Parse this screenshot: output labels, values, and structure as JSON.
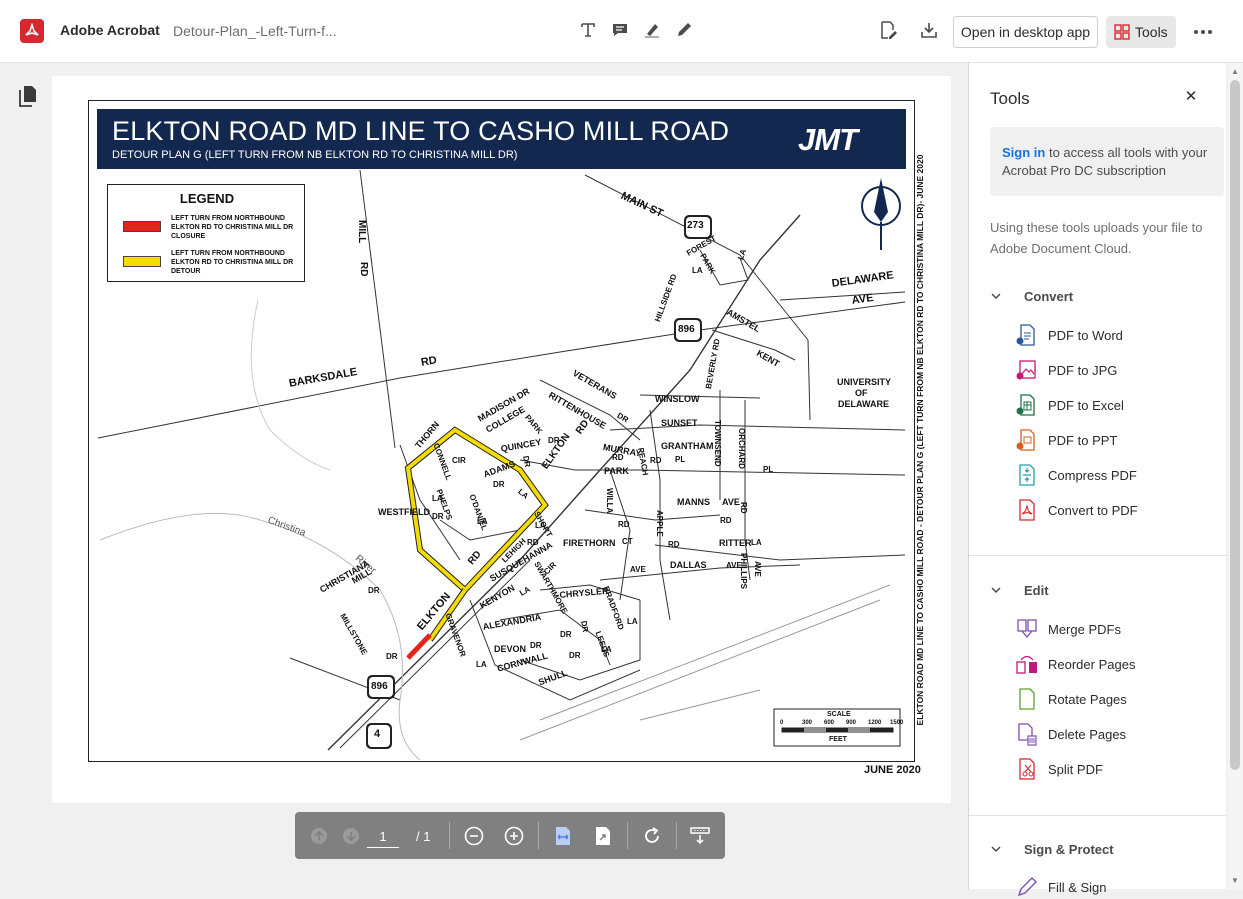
{
  "app": {
    "name": "Adobe Acrobat",
    "file_name": "Detour-Plan_-Left-Turn-f..."
  },
  "toolbar": {
    "open_desktop": "Open in desktop app",
    "tools_label": "Tools"
  },
  "map": {
    "title": "ELKTON ROAD MD LINE TO CASHO MILL ROAD",
    "subtitle": "DETOUR PLAN G (LEFT TURN FROM NB ELKTON RD TO CHRISTINA MILL DR)",
    "logo": "JMT",
    "legend_title": "LEGEND",
    "legend_closure": "LEFT TURN FROM NORTHBOUND ELKTON RD TO CHRISTINA MILL DR CLOSURE",
    "legend_detour": "LEFT TURN FROM NORTHBOUND ELKTON RD TO CHRISTINA MILL DR DETOUR",
    "date": "JUNE 2020",
    "side_note": "ELKTON ROAD MD LINE TO CASHO MILL ROAD - DETOUR PLAN G (LEFT TURN FROM NB ELKTON RD TO CHRISTINA MILL DR)- JUNE 2020",
    "scale_label": "SCALE",
    "scale_unit": "FEET",
    "scale_ticks": [
      "0",
      "300",
      "600",
      "900",
      "1200",
      "1500"
    ],
    "closure_color": "#e1251b",
    "detour_color": "#f5dc00",
    "labels": {
      "main_st": "MAIN ST",
      "r273": "273",
      "forest_park": "FOREST",
      "park_la": "PARK",
      "la1": "LA",
      "la2": "LA",
      "delaware": "DELAWARE",
      "ave": "AVE",
      "amstel": "AMSTEL",
      "kent": "KENT",
      "r896a": "896",
      "hillside": "HILLSIDE RD",
      "mill": "MILL",
      "rd_mill": "RD",
      "barksdale": "BARKSDALE",
      "rd_bark": "RD",
      "univ1": "UNIVERSITY",
      "univ2": "OF",
      "univ3": "DELAWARE",
      "veterans": "VETERANS",
      "dr_vet": "DR",
      "rittenhouse": "RITTENHOUSE",
      "winslow": "WINSLOW",
      "beverly": "BEVERLY RD",
      "sunset": "SUNSET",
      "townsend": "TOWNSEND",
      "orchard": "ORCHARD",
      "madison": "MADISON DR",
      "college": "COLLEGE",
      "park_c": "PARK",
      "thorn": "THORN",
      "connell": "CONNELL",
      "cir": "CIR",
      "quincey": "QUINCEY",
      "dr_q": "DR",
      "dr_q2": "DR",
      "murray": "MURRAY",
      "rd_mur": "RD",
      "peach": "PEACH",
      "rd_pea": "RD",
      "grantham": "GRANTHAM",
      "pl": "PL",
      "pl2": "PL",
      "park2": "PARK",
      "adams": "ADAMS",
      "dr_ad": "DR",
      "elkton_rd1": "ELKTON",
      "rd_e1": "RD",
      "phelps": "PHELPS",
      "la_ph": "LA",
      "odaniel": "O'DANIEL",
      "la_od": "LA",
      "la_e": "LA",
      "willa": "WILLA",
      "rd_wil": "RD",
      "manns": "MANNS",
      "ave_m": "AVE",
      "rd_m": "RD",
      "westfield": "WESTFIELD",
      "dr_w": "DR",
      "short": "SHORT",
      "la_sh": "LA",
      "apple": "APPLE",
      "rd_ap": "RD",
      "rd_x": "RD",
      "ritter": "RITTER",
      "la_r": "LA",
      "phillips": "PHILLIPS",
      "ave_p": "AVE",
      "christina": "Christina",
      "river": "River",
      "firethorn": "FIRETHORN",
      "ct": "CT",
      "lehigh": "LEHIGH",
      "rd_leh": "RD",
      "swarthmore": "SWARTHMORE",
      "dallas": "DALLAS",
      "ave_d": "AVE",
      "ave_d2": "AVE",
      "susquehanna": "SUSQUEHANNA",
      "cir_s": "CIR",
      "elkton_rd2": "RD",
      "christiana": "CHRISTIANA",
      "mill2": "MILL",
      "dr_cm": "DR",
      "bradford": "BRADFORD",
      "la_b": "LA",
      "chrysler": "CHRYSLER",
      "kenyon": "KENYON",
      "la_k": "LA",
      "elkton2": "ELKTON",
      "gravenor": "GRAVENOR",
      "la_g": "LA",
      "alexandria": "ALEXANDRIA",
      "dr_al": "DR",
      "dr_x2": "DR",
      "leeds": "LEEDS",
      "la_le": "LA",
      "millstone": "MILLSTONE",
      "dr_ms": "DR",
      "devon": "DEVON",
      "dr_dv": "DR",
      "dr_x3": "DR",
      "cornwall": "CORNWALL",
      "shull": "SHULL",
      "r896b": "896",
      "r4": "4"
    }
  },
  "page_controls": {
    "current_page": "1",
    "total": "/ 1"
  },
  "panel": {
    "title": "Tools",
    "signin_link": "Sign in",
    "signin_rest": " to access all tools with your Acrobat Pro DC subscription",
    "upload_note": "Using these tools uploads your file to Adobe Document Cloud.",
    "sections": {
      "convert": {
        "label": "Convert",
        "items": [
          "PDF to Word",
          "PDF to JPG",
          "PDF to Excel",
          "PDF to PPT",
          "Compress PDF",
          "Convert to PDF"
        ]
      },
      "edit": {
        "label": "Edit",
        "items": [
          "Merge PDFs",
          "Reorder Pages",
          "Rotate Pages",
          "Delete Pages",
          "Split PDF"
        ]
      },
      "sign": {
        "label": "Sign & Protect",
        "items": [
          "Fill & Sign"
        ]
      }
    }
  },
  "colors": {
    "brand": "#d7282f",
    "link": "#1473e6",
    "map_header": "#13284e"
  }
}
